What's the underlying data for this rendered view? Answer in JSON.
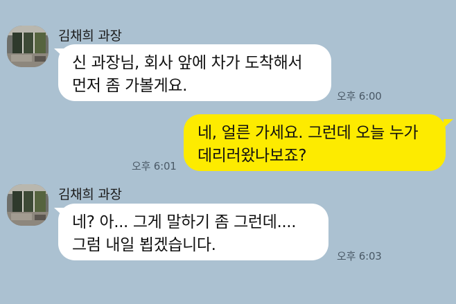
{
  "colors": {
    "background": "#abc1d1",
    "incoming_bubble": "#ffffff",
    "outgoing_bubble": "#fdeb00"
  },
  "messages": [
    {
      "sender": "김채희 과장",
      "direction": "incoming",
      "lines": [
        "신 과장님, 회사 앞에 차가 도착해서",
        "먼저 좀 가볼게요."
      ],
      "time": "오후 6:00"
    },
    {
      "direction": "outgoing",
      "lines": [
        "네, 얼른 가세요. 그런데 오늘 누가",
        "데리러왔나보죠?"
      ],
      "time": "오후 6:01"
    },
    {
      "sender": "김채희 과장",
      "direction": "incoming",
      "lines": [
        "네? 아... 그게 말하기 좀 그런데....",
        "그럼 내일 뵙겠습니다."
      ],
      "time": "오후 6:03"
    }
  ]
}
